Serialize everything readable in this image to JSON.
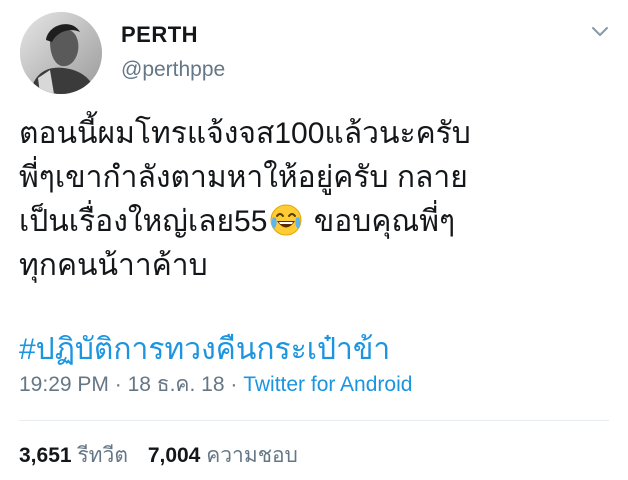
{
  "tweet": {
    "author_name": "PERTH",
    "author_handle": "@perthppe",
    "body_lines": [
      "ตอนนี้ผมโทรแจ้งจส100แล้วนะครับ",
      "พี่ๆเขากำลังตามหาให้อยู่ครับ กลาย",
      "เป็นเรื่องใหญ่เลย55",
      "ขอบคุณพี่ๆ",
      "ทุกคนน้าาค้าบ"
    ],
    "emoji": "face-with-tears-of-joy",
    "hashtag": "#ปฏิบัติการทวงคืนกระเป๋าข้า",
    "time": "19:29 PM",
    "date": "18 ธ.ค. 18",
    "separator": "·",
    "source": "Twitter for Android",
    "retweets_count": "3,651",
    "retweets_label": "รีทวีต",
    "likes_count": "7,004",
    "likes_label": "ความชอบ",
    "link_color": "#1b95e0"
  }
}
